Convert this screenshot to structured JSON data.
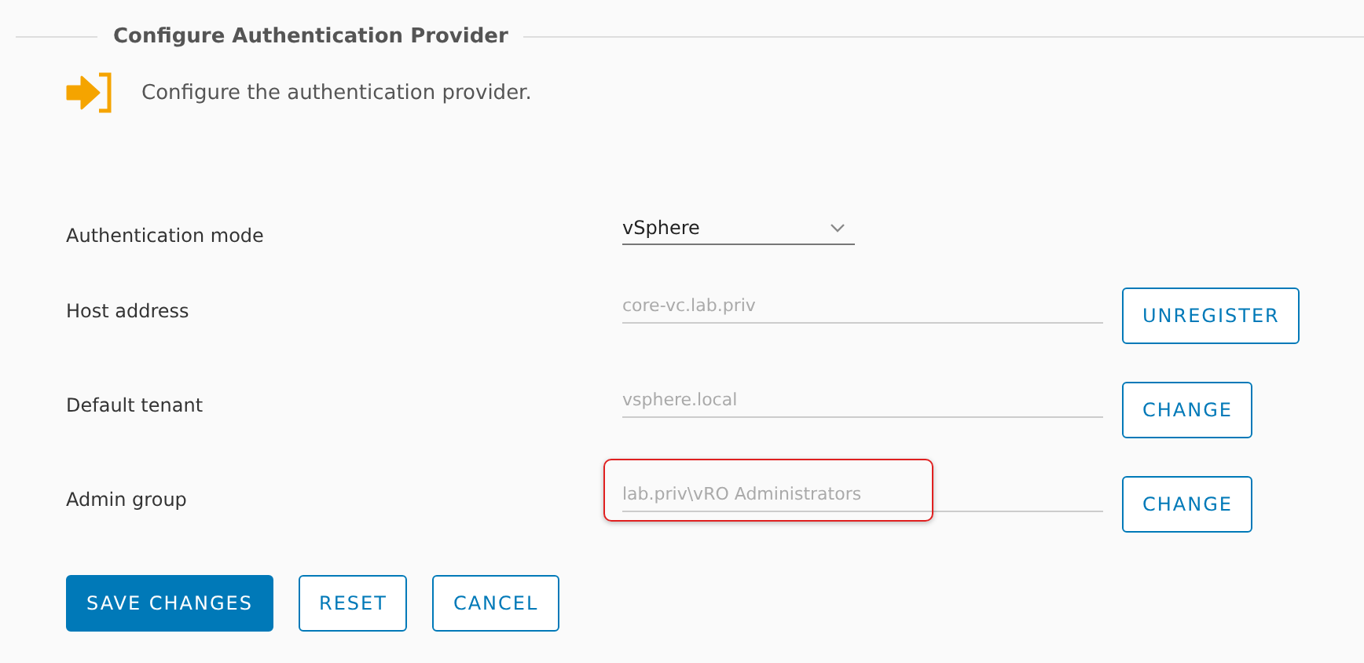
{
  "section": {
    "title": "Configure Authentication Provider",
    "description": "Configure the authentication provider."
  },
  "rows": [
    {
      "kind": "select",
      "label": "Authentication mode",
      "value": "vSphere",
      "highlighted": false
    },
    {
      "kind": "text",
      "label": "Host address",
      "value": "core-vc.lab.priv",
      "disabled": true,
      "highlighted": false,
      "button": "UNREGISTER"
    },
    {
      "kind": "text",
      "label": "Default tenant",
      "value": "vsphere.local",
      "disabled": true,
      "highlighted": false,
      "button": "CHANGE"
    },
    {
      "kind": "text",
      "label": "Admin group",
      "value": "lab.priv\\vRO Administrators",
      "disabled": true,
      "highlighted": true,
      "button": "CHANGE"
    }
  ],
  "actions": [
    {
      "label": "SAVE CHANGES",
      "primary": true
    },
    {
      "label": "RESET",
      "primary": false
    },
    {
      "label": "CANCEL",
      "primary": false
    }
  ]
}
